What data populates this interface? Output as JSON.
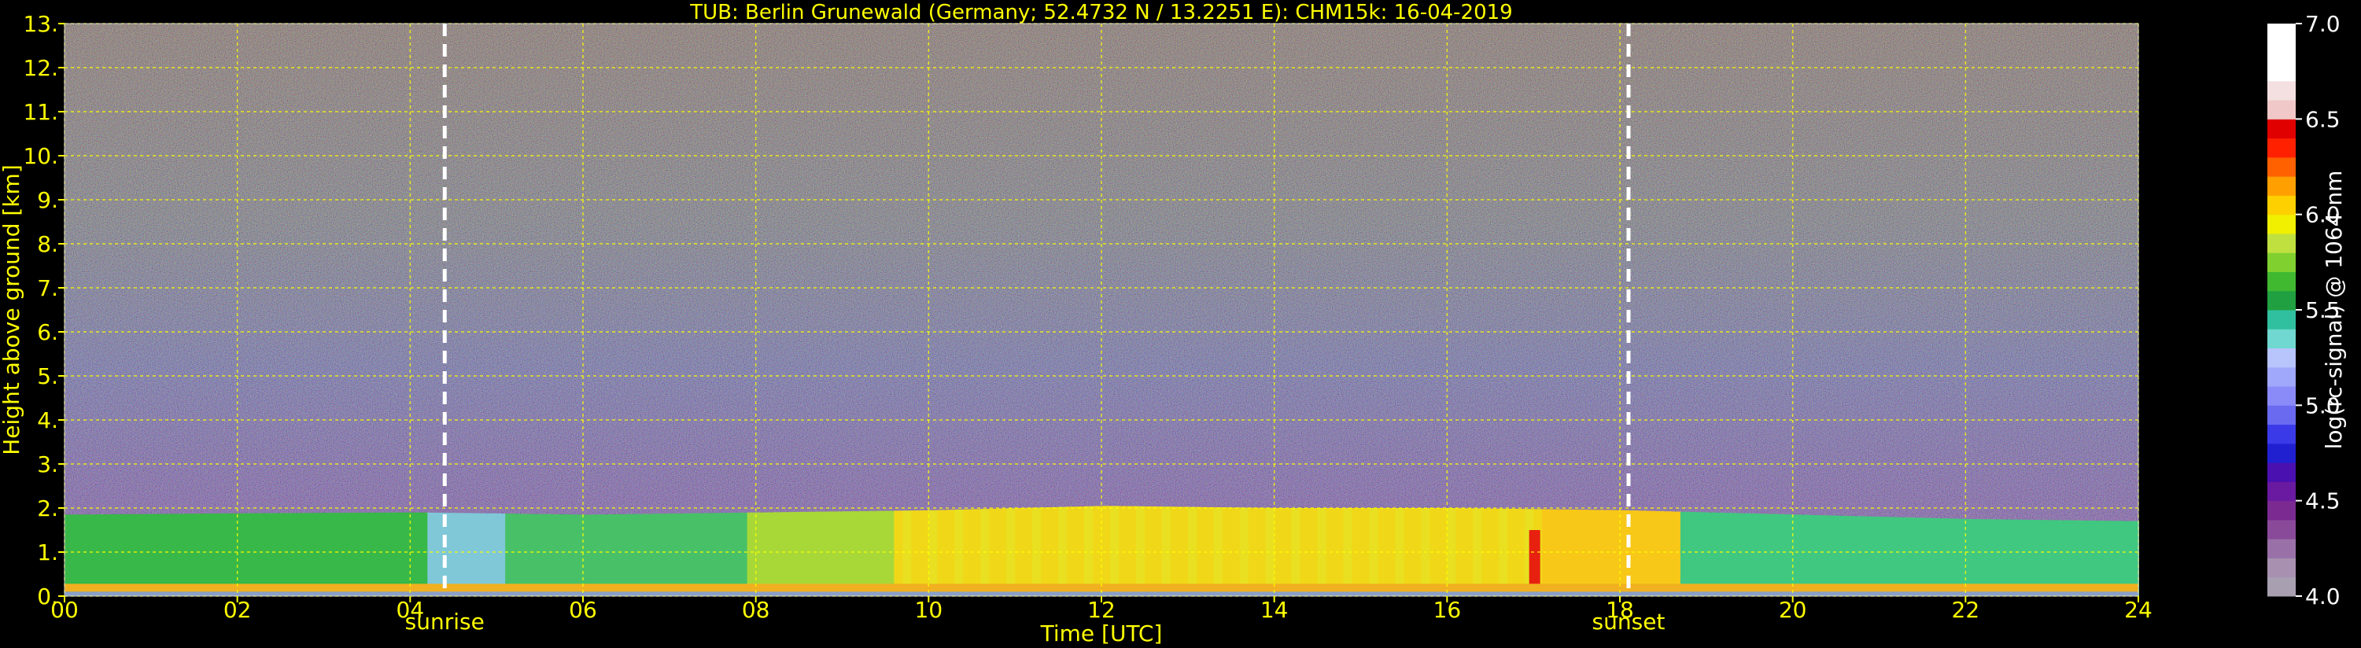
{
  "chart_data": {
    "type": "heatmap",
    "title": "TUB: Berlin Grunewald (Germany; 52.4732 N / 13.2251 E):    CHM15k: 16-04-2019",
    "xlabel": "Time [UTC]",
    "ylabel": "Height above ground [km]",
    "xlim": [
      0,
      24
    ],
    "ylim": [
      0,
      13
    ],
    "x_ticks": [
      "00",
      "02",
      "04",
      "06",
      "08",
      "10",
      "12",
      "14",
      "16",
      "18",
      "20",
      "22",
      "24"
    ],
    "y_ticks": [
      "0.",
      "1.",
      "2.",
      "3.",
      "4.",
      "5.",
      "6.",
      "7.",
      "8.",
      "9.",
      "10.",
      "11.",
      "12.",
      "13."
    ],
    "grid": true,
    "annotations": [
      {
        "label": "sunrise",
        "x": 4.4
      },
      {
        "label": "sunset",
        "x": 18.1
      }
    ],
    "colorbar": {
      "label": "log(rc-signal) @ 1064 nm",
      "range": [
        4.0,
        7.0
      ],
      "ticks": [
        "4.0",
        "4.5",
        "5.0",
        "5.5",
        "6.0",
        "6.5",
        "7.0"
      ],
      "colors": [
        "#a8a0b0",
        "#a890b0",
        "#9a70a8",
        "#8a4a9a",
        "#7a2a90",
        "#6a1aa0",
        "#4a10b0",
        "#2020d0",
        "#3a3ae8",
        "#6a6af0",
        "#8a8af8",
        "#a0a8fc",
        "#b8c4fc",
        "#70d8d0",
        "#30c0a0",
        "#20a040",
        "#40b830",
        "#80d030",
        "#c0e040",
        "#f0f000",
        "#ffd000",
        "#ffa000",
        "#ff6000",
        "#ff2000",
        "#e00000",
        "#f0c8c8",
        "#f4e0e0",
        "#ffffff",
        "#ffffff",
        "#ffffff"
      ]
    },
    "boundary_layer_top_km": [
      [
        0,
        1.85
      ],
      [
        2,
        1.88
      ],
      [
        4,
        1.9
      ],
      [
        6,
        1.85
      ],
      [
        8,
        1.9
      ],
      [
        10,
        1.95
      ],
      [
        12,
        2.05
      ],
      [
        14,
        2.0
      ],
      [
        16,
        2.0
      ],
      [
        18,
        1.95
      ],
      [
        20,
        1.85
      ],
      [
        22,
        1.75
      ],
      [
        24,
        1.7
      ]
    ]
  }
}
